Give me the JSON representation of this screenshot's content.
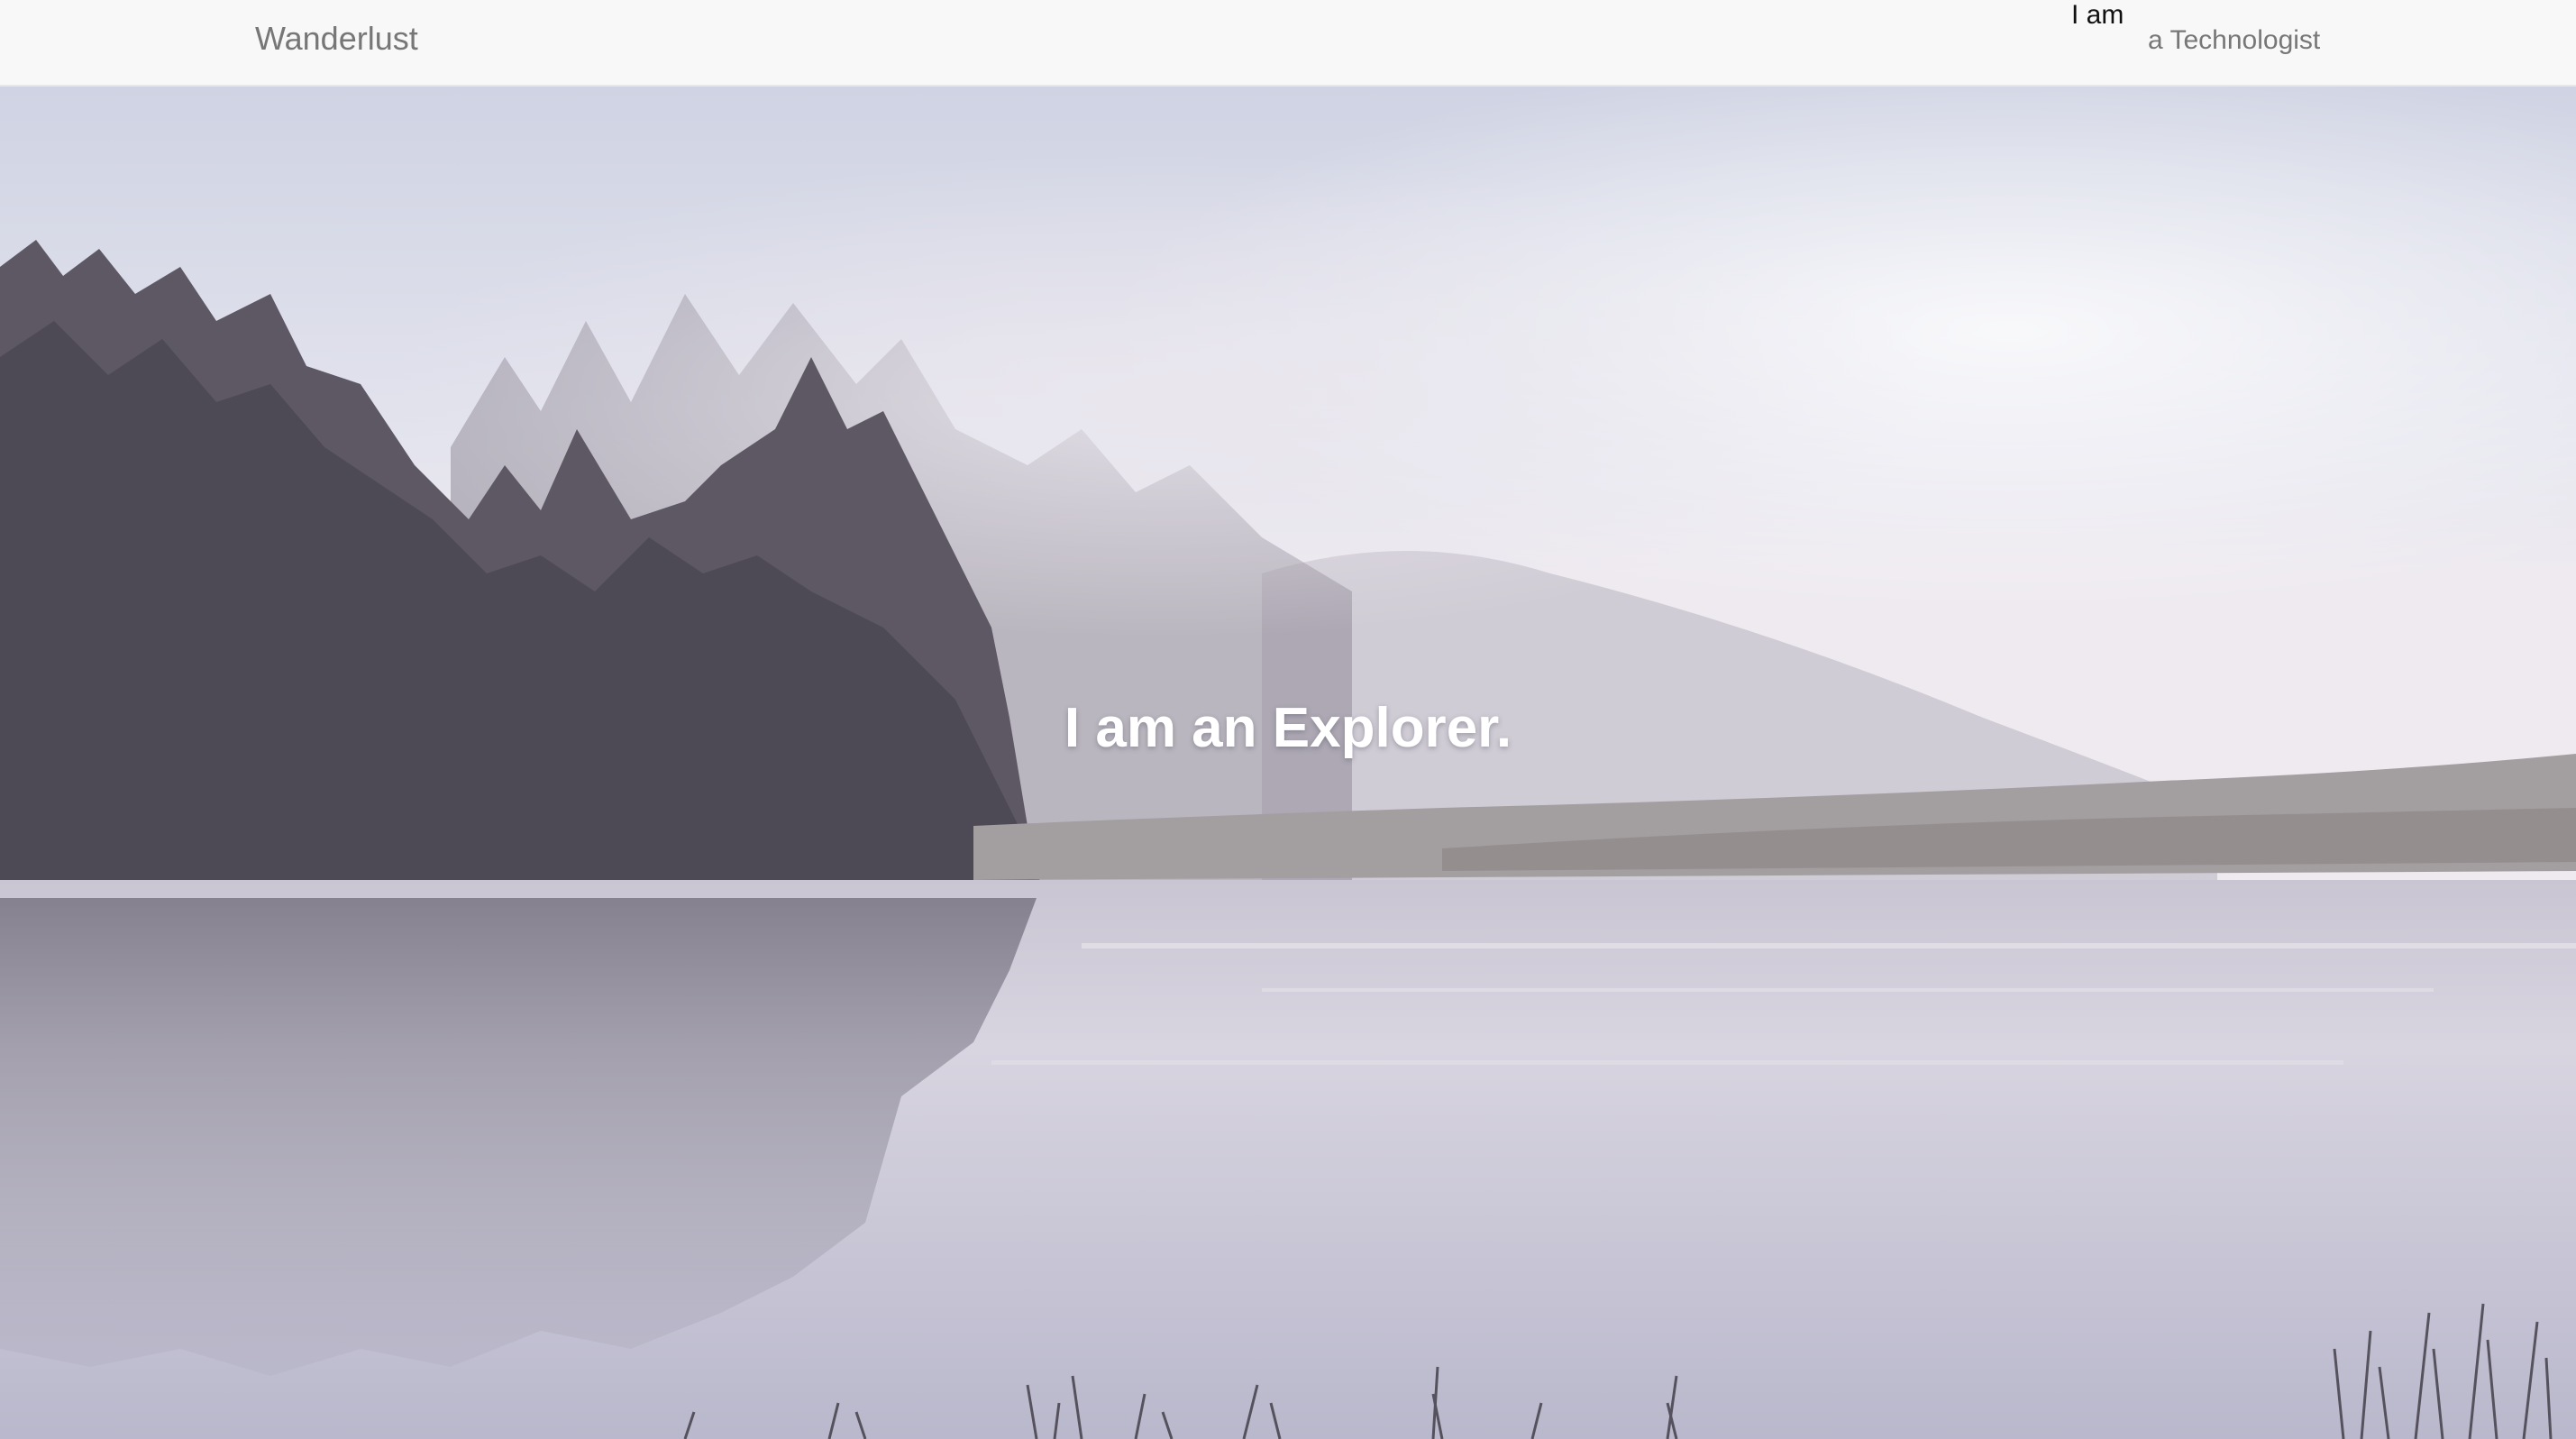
{
  "navbar": {
    "brand": "Wanderlust",
    "prefix": "I am",
    "link": "a Technologist"
  },
  "hero": {
    "title": "I am an Explorer.",
    "image_description_icon": "misty-lake-forest-photo"
  },
  "colors": {
    "navbar_bg": "#f8f8f8",
    "brand_text": "#777777",
    "hero_text": "#ffffff"
  }
}
